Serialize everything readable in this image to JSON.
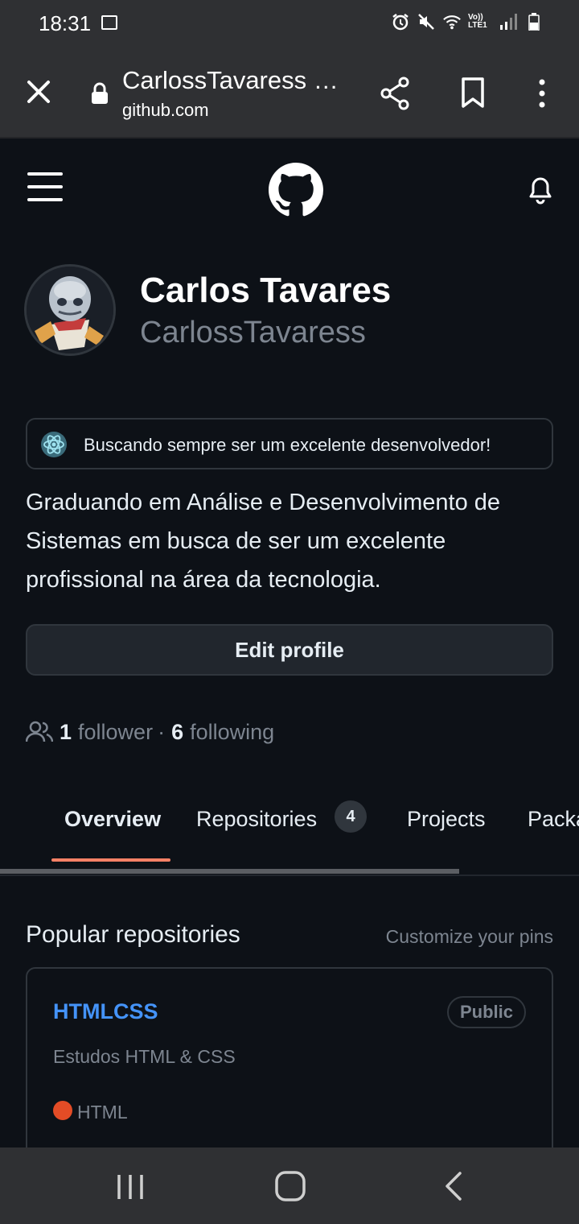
{
  "status_bar": {
    "time": "18:31",
    "network_label": "Vo)) LTE1"
  },
  "browser": {
    "title": "CarlossTavaress …",
    "domain": "github.com"
  },
  "profile": {
    "name": "Carlos Tavares",
    "login": "CarlossTavaress",
    "status": "Buscando sempre ser um excelente desenvolvedor!",
    "bio": "Graduando em Análise e Desenvolvimento de Sistemas em busca de ser um excelente profissional na área da tecnologia.",
    "edit_button": "Edit profile",
    "followers_count": "1",
    "followers_label": "follower",
    "separator": "·",
    "following_count": "6",
    "following_label": "following"
  },
  "tabs": [
    {
      "label": "Overview"
    },
    {
      "label": "Repositories",
      "count": "4"
    },
    {
      "label": "Projects"
    },
    {
      "label": "Packa"
    }
  ],
  "popular": {
    "title": "Popular repositories",
    "customize": "Customize your pins",
    "repos": [
      {
        "name": "HTMLCSS",
        "visibility": "Public",
        "description": "Estudos HTML & CSS",
        "language": "HTML",
        "language_color": "#e34c26"
      }
    ]
  },
  "colors": {
    "background": "#0d1117",
    "accent_underline": "#f78166",
    "link": "#4493f8",
    "muted": "#7d8590",
    "chrome": "#2f3033"
  }
}
